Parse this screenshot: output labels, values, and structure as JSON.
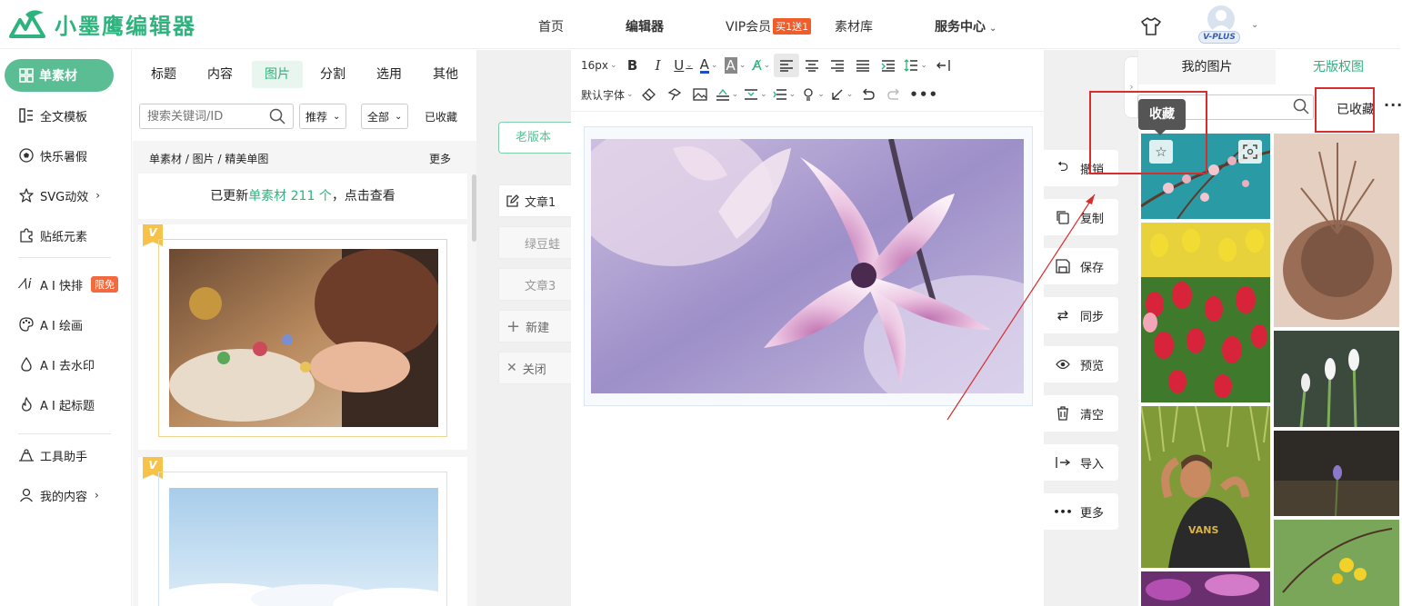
{
  "header": {
    "logo_text": "小墨鹰编辑器",
    "nav": [
      "首页",
      "编辑器",
      "VIP会员",
      "素材库",
      "服务中心"
    ],
    "vip_badge": "买1送1",
    "avatar_badge": "V-PLUS"
  },
  "sidebar": {
    "items": [
      {
        "label": "单素材",
        "icon": "grid-icon"
      },
      {
        "label": "全文模板",
        "icon": "template-icon"
      },
      {
        "label": "快乐暑假",
        "icon": "ball-icon"
      },
      {
        "label": "SVG动效",
        "icon": "star-icon"
      },
      {
        "label": "贴纸元素",
        "icon": "puzzle-icon"
      },
      {
        "label": "A I 快排",
        "icon": "ai-icon"
      },
      {
        "label": "A I 绘画",
        "icon": "palette-icon"
      },
      {
        "label": "A I 去水印",
        "icon": "drop-icon"
      },
      {
        "label": "A I 起标题",
        "icon": "flame-icon"
      },
      {
        "label": "工具助手",
        "icon": "tool-icon"
      },
      {
        "label": "我的内容",
        "icon": "user-icon"
      }
    ],
    "limit_badge": "限免"
  },
  "material": {
    "tabs": [
      "标题",
      "内容",
      "图片",
      "分割",
      "选用",
      "其他"
    ],
    "active_tab": "图片",
    "search_placeholder": "搜索关键词/ID",
    "filter_recommend": "推荐",
    "filter_all": "全部",
    "favorites": "已收藏",
    "breadcrumb": "单素材 / 图片 / 精美单图",
    "more": "更多",
    "update_prefix": "已更新",
    "update_highlight": "单素材 211 个",
    "update_suffix": "，点击查看"
  },
  "articles": {
    "old_version": "老版本",
    "items": [
      "文章1",
      "绿豆蛙",
      "文章3"
    ],
    "new": "新建",
    "close": "关闭"
  },
  "toolbar": {
    "font_size": "16px",
    "font_family": "默认字体"
  },
  "actions": [
    "撤销",
    "复制",
    "保存",
    "同步",
    "预览",
    "清空",
    "导入",
    "更多"
  ],
  "right_panel": {
    "tab_my_images": "我的图片",
    "tab_free": "无版权图",
    "favorites": "已收藏",
    "tooltip": "收藏"
  },
  "colors": {
    "brand": "#2eb37e",
    "badge_orange": "#f05c2a",
    "annotation_red": "#d62e2e"
  }
}
